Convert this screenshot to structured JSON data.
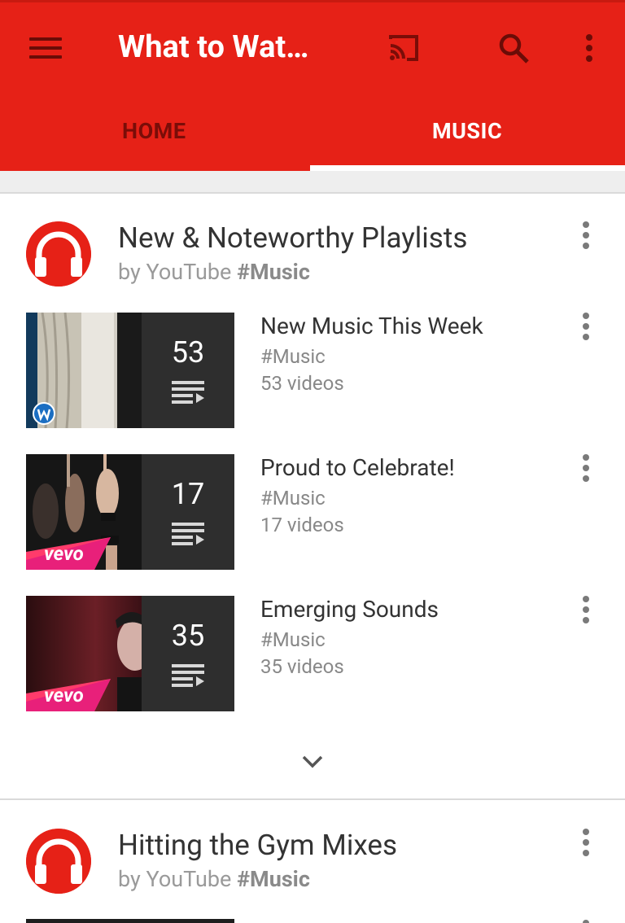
{
  "app": {
    "title": "What to Wat…",
    "colors": {
      "brand": "#e62117",
      "tab_inactive": "#7a0d08",
      "text_primary": "#333333",
      "text_secondary": "#888888"
    }
  },
  "toolbar": {
    "icons": [
      "menu-icon",
      "cast-icon",
      "search-icon",
      "more-vert-icon"
    ]
  },
  "tabs": [
    {
      "label": "HOME",
      "selected": false
    },
    {
      "label": "MUSIC",
      "selected": true
    }
  ],
  "shelves": [
    {
      "title": "New & Noteworthy Playlists",
      "by": "by YouTube ",
      "channel": "#Music",
      "playlists": [
        {
          "title": "New Music This Week",
          "tag": "#Music",
          "videos": "53 videos",
          "count": "53",
          "badge": "warner-icon"
        },
        {
          "title": "Proud to Celebrate!",
          "tag": "#Music",
          "videos": "17 videos",
          "count": "17",
          "badge": "vevo-logo"
        },
        {
          "title": "Emerging Sounds",
          "tag": "#Music",
          "videos": "35 videos",
          "count": "35",
          "badge": "vevo-logo"
        }
      ]
    },
    {
      "title": "Hitting the Gym Mixes",
      "by": "by YouTube ",
      "channel": "#Music",
      "playlists": []
    }
  ],
  "logos": {
    "vevo": "vevo"
  }
}
